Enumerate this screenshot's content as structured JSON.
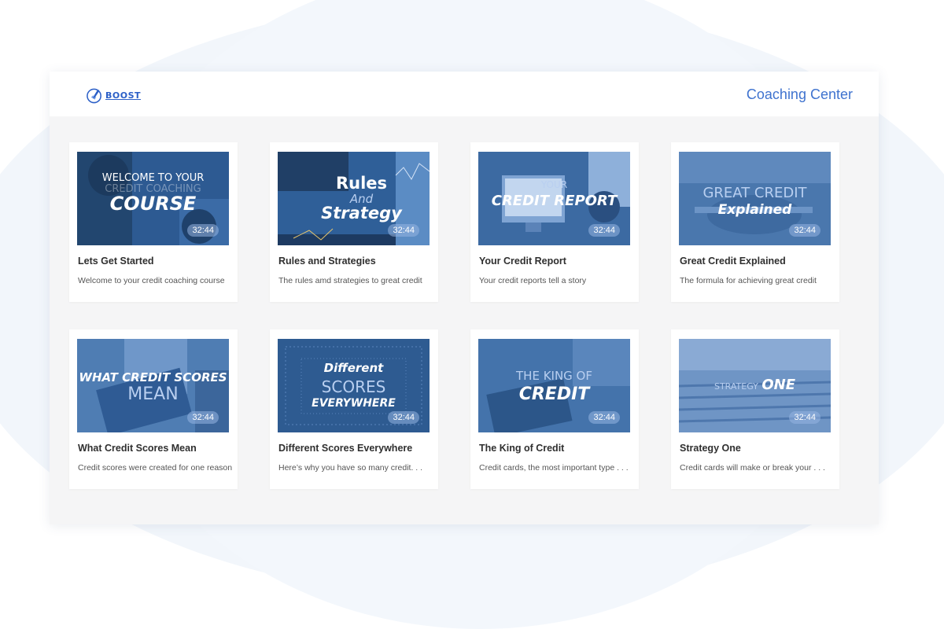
{
  "header": {
    "logo_text": "BOOST",
    "title": "Coaching Center"
  },
  "colors": {
    "accent": "#3f73cf",
    "thumb_tint": "#3a6aa6",
    "panel_bg": "#f5f5f6"
  },
  "courses": [
    {
      "title": "Lets Get Started",
      "description": "Welcome to your credit coaching course",
      "duration": "32:44",
      "thumb_lines": [
        "WELCOME TO YOUR",
        "CREDIT COACHING",
        "COURSE"
      ]
    },
    {
      "title": "Rules and Strategies",
      "description": "The rules amd strategies  to great credit",
      "duration": "32:44",
      "thumb_lines": [
        "Rules",
        "And",
        "Strategy"
      ]
    },
    {
      "title": "Your Credit Report",
      "description": "Your credit reports tell a story",
      "duration": "32:44",
      "thumb_lines": [
        "YOUR",
        "CREDIT REPORT"
      ]
    },
    {
      "title": "Great Credit Explained",
      "description": "The formula for achieving great credit",
      "duration": "32:44",
      "thumb_lines": [
        "GREAT CREDIT",
        "Explained"
      ]
    },
    {
      "title": "What Credit Scores Mean",
      "description": "Credit scores were created for one reason",
      "duration": "32:44",
      "thumb_lines": [
        "WHAT CREDIT SCORES",
        "MEAN"
      ]
    },
    {
      "title": "Different Scores Everywhere",
      "description": "Here’s why you have so many  credit. . .",
      "duration": "32:44",
      "thumb_lines": [
        "Different",
        "SCORES",
        "EVERYWHERE"
      ]
    },
    {
      "title": "The King of Credit",
      "description": "Credit cards, the most important type . . .",
      "duration": "32:44",
      "thumb_lines": [
        "THE KING OF",
        "CREDIT"
      ]
    },
    {
      "title": "Strategy One",
      "description": "Credit cards will make or break your . . .",
      "duration": "32:44",
      "thumb_lines": [
        "STRATEGY",
        "ONE"
      ]
    }
  ]
}
